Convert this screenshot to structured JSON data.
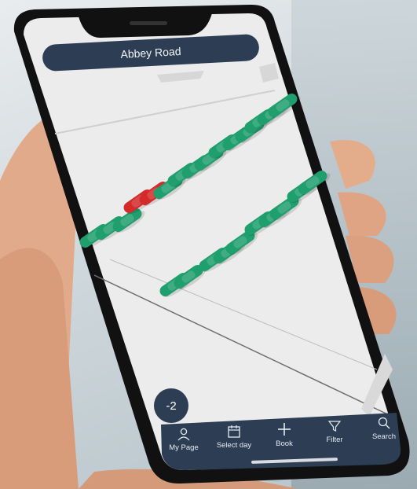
{
  "header": {
    "title": "Abbey Road"
  },
  "floor": {
    "label": "-2"
  },
  "tabs": [
    {
      "label": "My Page",
      "icon": "user-icon"
    },
    {
      "label": "Select day",
      "icon": "calendar-icon"
    },
    {
      "label": "Book",
      "icon": "plus-icon"
    },
    {
      "label": "Filter",
      "icon": "filter-icon"
    },
    {
      "label": "Search",
      "icon": "search-icon"
    }
  ],
  "colors": {
    "available": "#1f9e6e",
    "occupied": "#d42a2a",
    "navy": "#2c3d54",
    "floor": "#ececec"
  },
  "parking": {
    "occupied_count": 2
  }
}
